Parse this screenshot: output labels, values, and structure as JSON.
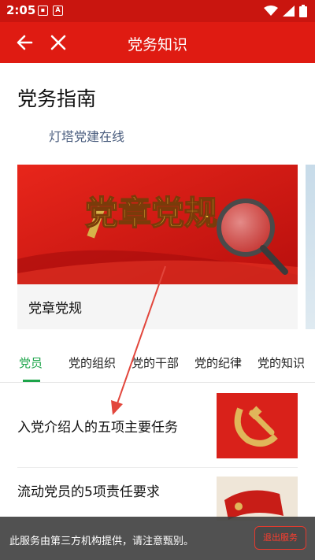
{
  "status_bar": {
    "time": "2:05",
    "icons": [
      "image-icon",
      "text-a-icon",
      "wifi-icon",
      "signal-icon",
      "battery-icon"
    ]
  },
  "header": {
    "title": "党务知识",
    "back_icon": "arrow-left-icon",
    "close_icon": "close-icon"
  },
  "guide": {
    "heading": "党务指南",
    "provider": "灯塔党建在线"
  },
  "card": {
    "banner_text": "党章党规",
    "title": "党章党规"
  },
  "tabs": [
    {
      "label": "党员",
      "active": true
    },
    {
      "label": "党的组织",
      "active": false
    },
    {
      "label": "党的干部",
      "active": false
    },
    {
      "label": "党的纪律",
      "active": false
    },
    {
      "label": "党的知识",
      "active": false
    }
  ],
  "articles": [
    {
      "title": "入党介绍人的五项主要任务"
    },
    {
      "title": "流动党员的5项责任要求"
    }
  ],
  "toast": {
    "message": "此服务由第三方机构提供，请注意甄别。",
    "button": "退出服务"
  },
  "colors": {
    "status_bar": "#c9150f",
    "title_bar": "#df1b12",
    "active_tab": "#1da44a",
    "arrow": "#e2463c"
  }
}
